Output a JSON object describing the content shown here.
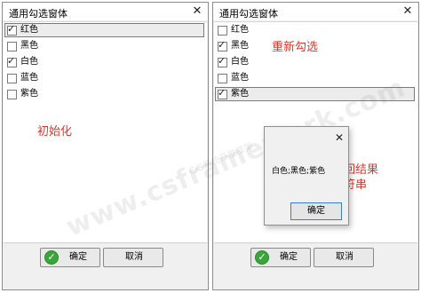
{
  "left_window": {
    "title": "通用勾选窗体",
    "items": [
      {
        "label": "红色",
        "checked": true
      },
      {
        "label": "黑色",
        "checked": false
      },
      {
        "label": "白色",
        "checked": true
      },
      {
        "label": "蓝色",
        "checked": false
      },
      {
        "label": "紫色",
        "checked": false
      }
    ],
    "ok_label": "确定",
    "cancel_label": "取消"
  },
  "right_window": {
    "title": "通用勾选窗体",
    "items": [
      {
        "label": "红色",
        "checked": false
      },
      {
        "label": "黑色",
        "checked": true
      },
      {
        "label": "白色",
        "checked": true
      },
      {
        "label": "蓝色",
        "checked": false
      },
      {
        "label": "紫色",
        "checked": true
      }
    ],
    "ok_label": "确定",
    "cancel_label": "取消"
  },
  "annotations": {
    "initialize": "初始化",
    "reselect": "重新勾选",
    "return_line1": "返回结果",
    "return_line2": "字符串"
  },
  "dialog": {
    "message": "白色;黑色;紫色",
    "ok_label": "确定"
  },
  "watermark": {
    "main": "www.csframework.com",
    "sub": "C/S系统开发框架"
  },
  "colors": {
    "annotation_red": "#e0362c",
    "ok_icon_green": "#3aa53a",
    "dialog_button_border": "#3d7cc9"
  },
  "icons": {
    "check": "check-mark",
    "close": "close-x",
    "ok": "green-check-circle"
  }
}
